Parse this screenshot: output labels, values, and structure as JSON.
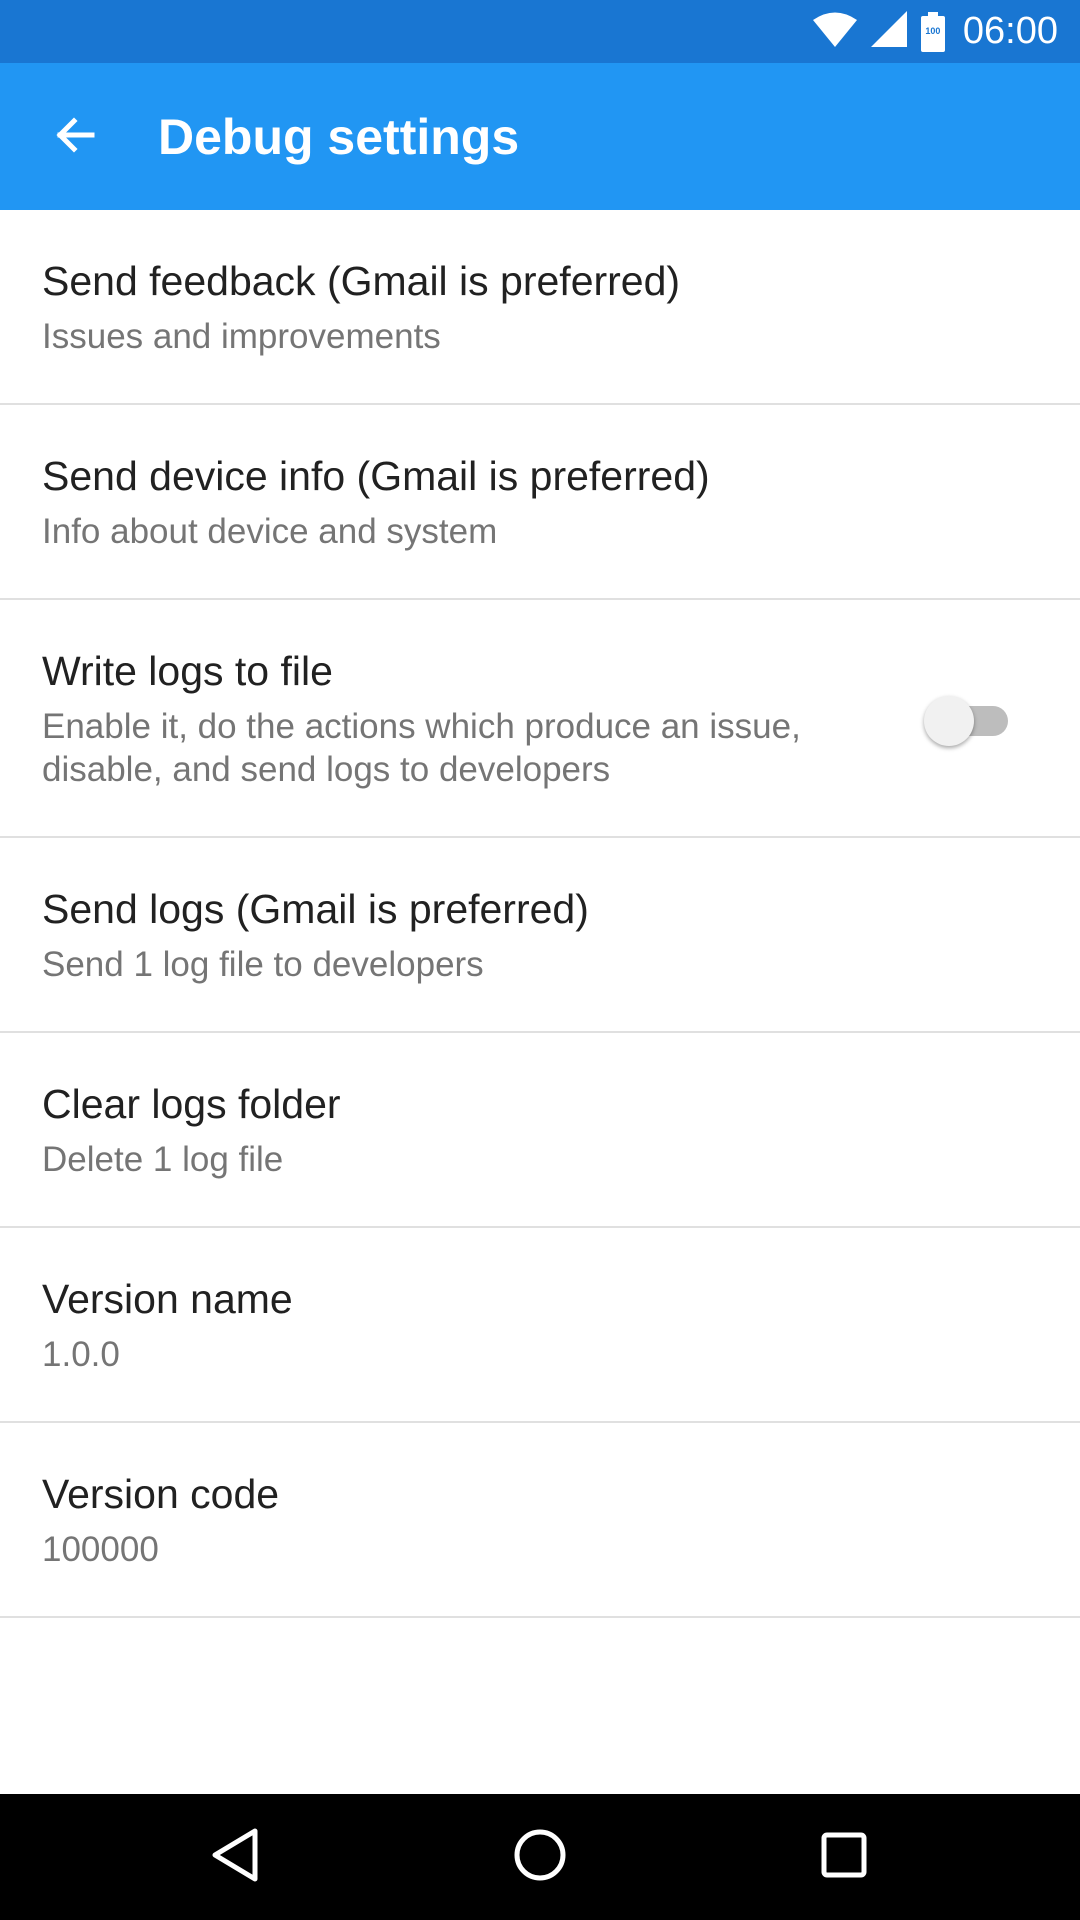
{
  "status_bar": {
    "time": "06:00",
    "battery_level": "100",
    "icons": [
      "wifi-icon",
      "cell-signal-icon",
      "battery-icon"
    ],
    "background": "#1976D2"
  },
  "app_bar": {
    "title": "Debug settings",
    "back_icon": "arrow-back-icon",
    "background": "#2196F3"
  },
  "settings": [
    {
      "title": "Send feedback (Gmail is preferred)",
      "summary": "Issues and improvements"
    },
    {
      "title": "Send device info (Gmail is preferred)",
      "summary": "Info about device and system"
    },
    {
      "title": "Write logs to file",
      "summary": "Enable it, do the actions which produce an issue, disable, and send logs to developers",
      "switch_on": false
    },
    {
      "title": "Send logs (Gmail is preferred)",
      "summary": "Send 1 log file to developers"
    },
    {
      "title": "Clear logs folder",
      "summary": "Delete 1 log file"
    },
    {
      "title": "Version name",
      "summary": "1.0.0"
    },
    {
      "title": "Version code",
      "summary": "100000"
    }
  ],
  "nav_bar": {
    "buttons": [
      "back-triangle-icon",
      "home-circle-icon",
      "recents-square-icon"
    ]
  }
}
